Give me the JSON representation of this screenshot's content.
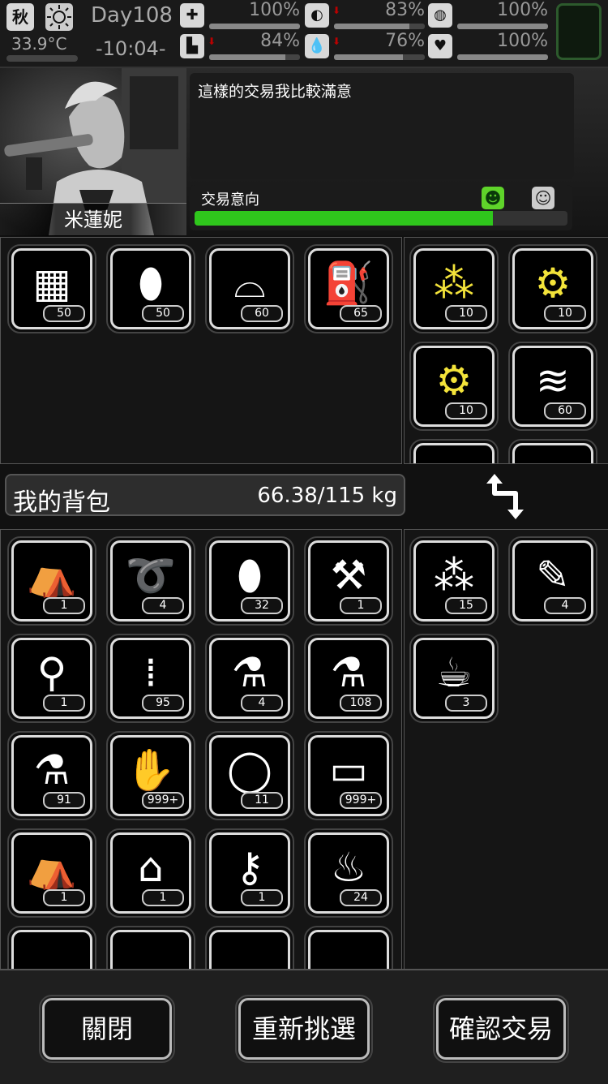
{
  "status": {
    "season": "秋",
    "weather_icon": "sun-icon",
    "temperature": "33.9°C",
    "day": "Day108",
    "time": "-10:04-",
    "stats": [
      {
        "icon": "medkit-icon",
        "value": "100%",
        "level": 1.0,
        "down": false
      },
      {
        "icon": "stomach-icon",
        "value": "83%",
        "level": 0.83,
        "down": true
      },
      {
        "icon": "mind-icon",
        "value": "100%",
        "level": 1.0,
        "down": false
      },
      {
        "icon": "boot-icon",
        "value": "84%",
        "level": 0.84,
        "down": true
      },
      {
        "icon": "water-drop-icon",
        "value": "76%",
        "level": 0.76,
        "down": true
      },
      {
        "icon": "heart-icon",
        "value": "100%",
        "level": 1.0,
        "down": false
      }
    ]
  },
  "trader": {
    "name": "米蓮妮",
    "speech": "這樣的交易我比較滿意",
    "intent_label": "交易意向",
    "intent_level": 0.8,
    "colors": {
      "intent": "#2fc71c",
      "happy_face": "#5fd42a"
    }
  },
  "trader_offer": [
    {
      "icon": "bricks-icon",
      "count": "50"
    },
    {
      "icon": "bottle-icon",
      "count": "50"
    },
    {
      "icon": "cloth-icon",
      "count": "60"
    },
    {
      "icon": "fuel-barrel-icon",
      "count": "65"
    }
  ],
  "trader_inventory": [
    {
      "icon": "scrap-parts-icon",
      "count": "10",
      "highlight": true
    },
    {
      "icon": "gun-parts-icon",
      "count": "10",
      "highlight": true
    },
    {
      "icon": "gears-icon",
      "count": "10",
      "highlight": true
    },
    {
      "icon": "fabric-icon",
      "count": "60",
      "highlight": false
    }
  ],
  "backpack": {
    "title": "我的背包",
    "weight": "66.38/115 kg"
  },
  "my_items": [
    {
      "icon": "backpack-icon",
      "count": "1"
    },
    {
      "icon": "rope-icon",
      "count": "4"
    },
    {
      "icon": "bottle-icon",
      "count": "32"
    },
    {
      "icon": "axe-icon",
      "count": "1"
    },
    {
      "icon": "shovel-icon",
      "count": "1"
    },
    {
      "icon": "bullets-icon",
      "count": "95"
    },
    {
      "icon": "vial-vi-icon",
      "count": "4"
    },
    {
      "icon": "vial-ii-icon",
      "count": "108"
    },
    {
      "icon": "vial-i-icon",
      "count": "91"
    },
    {
      "icon": "zombie-card-icon",
      "count": "999+"
    },
    {
      "icon": "ring-icon",
      "count": "11"
    },
    {
      "icon": "cash-stack-icon",
      "count": "999+"
    },
    {
      "icon": "hiking-backpack-icon",
      "count": "1"
    },
    {
      "icon": "school-backpack-icon",
      "count": "1"
    },
    {
      "icon": "key-icon",
      "count": "1"
    },
    {
      "icon": "popcorn-icon",
      "count": "24"
    }
  ],
  "my_offer": [
    {
      "icon": "spray-cans-icon",
      "count": "15"
    },
    {
      "icon": "scroll-icon",
      "count": "4"
    },
    {
      "icon": "cola-cup-icon",
      "count": "3"
    }
  ],
  "buttons": {
    "close": "關閉",
    "reselect": "重新挑選",
    "confirm": "確認交易"
  }
}
